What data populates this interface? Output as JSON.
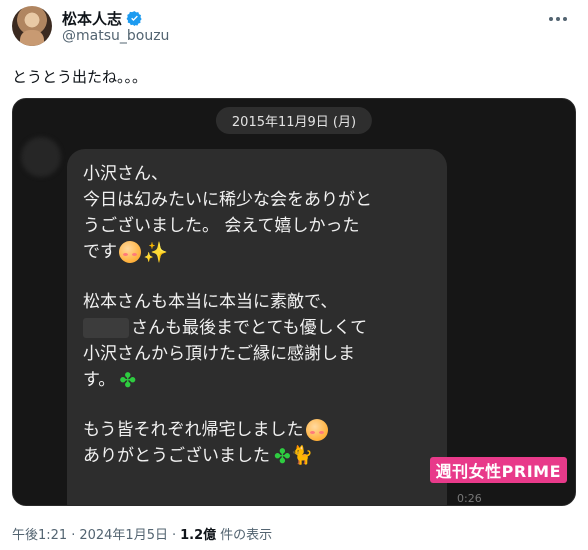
{
  "author": {
    "name": "松本人志",
    "handle": "@matsu_bouzu",
    "verified": true
  },
  "tweet": {
    "text": "とうとう出たね。。。"
  },
  "media": {
    "date_header": "2015年11月9日 (月)",
    "message_lines": [
      "小沢さん、",
      "今日は幻みたいに稀少な会をありがと",
      "うございました。 会えて嬉しかった",
      "です",
      "松本さんも本当に本当に素敵で、",
      "さんも最後までとても優しくて",
      "小沢さんから頂けたご縁に感謝しま",
      "す。",
      "もう皆それぞれ帰宅しました",
      "ありがとうございました"
    ],
    "time": "0:26",
    "watermark": "週刊女性PRIME"
  },
  "meta": {
    "time": "午後1:21",
    "date": "2024年1月5日",
    "views_count": "1.2億",
    "views_label": "件の表示"
  },
  "icons": {
    "verified": "verified-badge-icon",
    "more": "more-icon"
  },
  "colors": {
    "verified": "#1d9bf0",
    "watermark": "#e83a8a"
  }
}
